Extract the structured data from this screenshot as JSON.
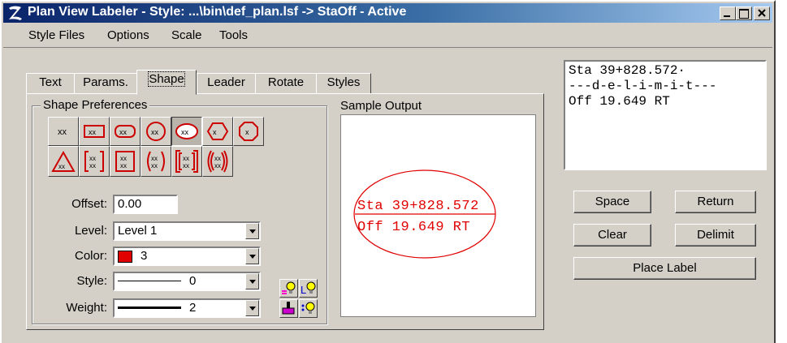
{
  "window": {
    "title": "Plan View Labeler - Style: ...\\bin\\def_plan.lsf -> StaOff - Active",
    "app_icon": "z-logo-icon",
    "controls": [
      "minimize-icon",
      "maximize-icon",
      "close-icon"
    ]
  },
  "menu": [
    "Style Files",
    "Options",
    "Scale",
    "Tools"
  ],
  "tabs": [
    {
      "label": "Text",
      "active": false
    },
    {
      "label": "Params.",
      "active": false
    },
    {
      "label": "Shape",
      "active": true
    },
    {
      "label": "Leader",
      "active": false
    },
    {
      "label": "Rotate",
      "active": false
    },
    {
      "label": "Styles",
      "active": false
    }
  ],
  "shape_preferences": {
    "title": "Shape Preferences",
    "row1": [
      "plain",
      "rectangle",
      "rounded",
      "circle",
      "ellipse",
      "hexagon",
      "octagon"
    ],
    "row2": [
      "triangle",
      "bracket-square",
      "bracket-square-lines",
      "paren",
      "double-bracket",
      "double-paren"
    ],
    "selected": "ellipse",
    "none_label": "xx"
  },
  "fields": {
    "offset_label": "Offset:",
    "offset_value": "0.00",
    "level_label": "Level:",
    "level_value": "Level 1",
    "color_label": "Color:",
    "color_value": "3",
    "color_swatch": "#e00000",
    "style_label": "Style:",
    "style_value": "0",
    "weight_label": "Weight:",
    "weight_value": "2"
  },
  "sample": {
    "label": "Sample Output",
    "line1": "Sta 39+828.572",
    "line2": "Off 19.649 RT",
    "color": "#e00000"
  },
  "label_text": "Sta 39+828.572·\n---d-e-l-i-m-i-t---\nOff 19.649 RT",
  "buttons": {
    "space": "Space",
    "return": "Return",
    "clear": "Clear",
    "delimit": "Delimit",
    "place_label": "Place Label"
  },
  "colors": {
    "title_start": "#0a246a",
    "title_end": "#a6caf0",
    "face": "#d4d0c8"
  }
}
